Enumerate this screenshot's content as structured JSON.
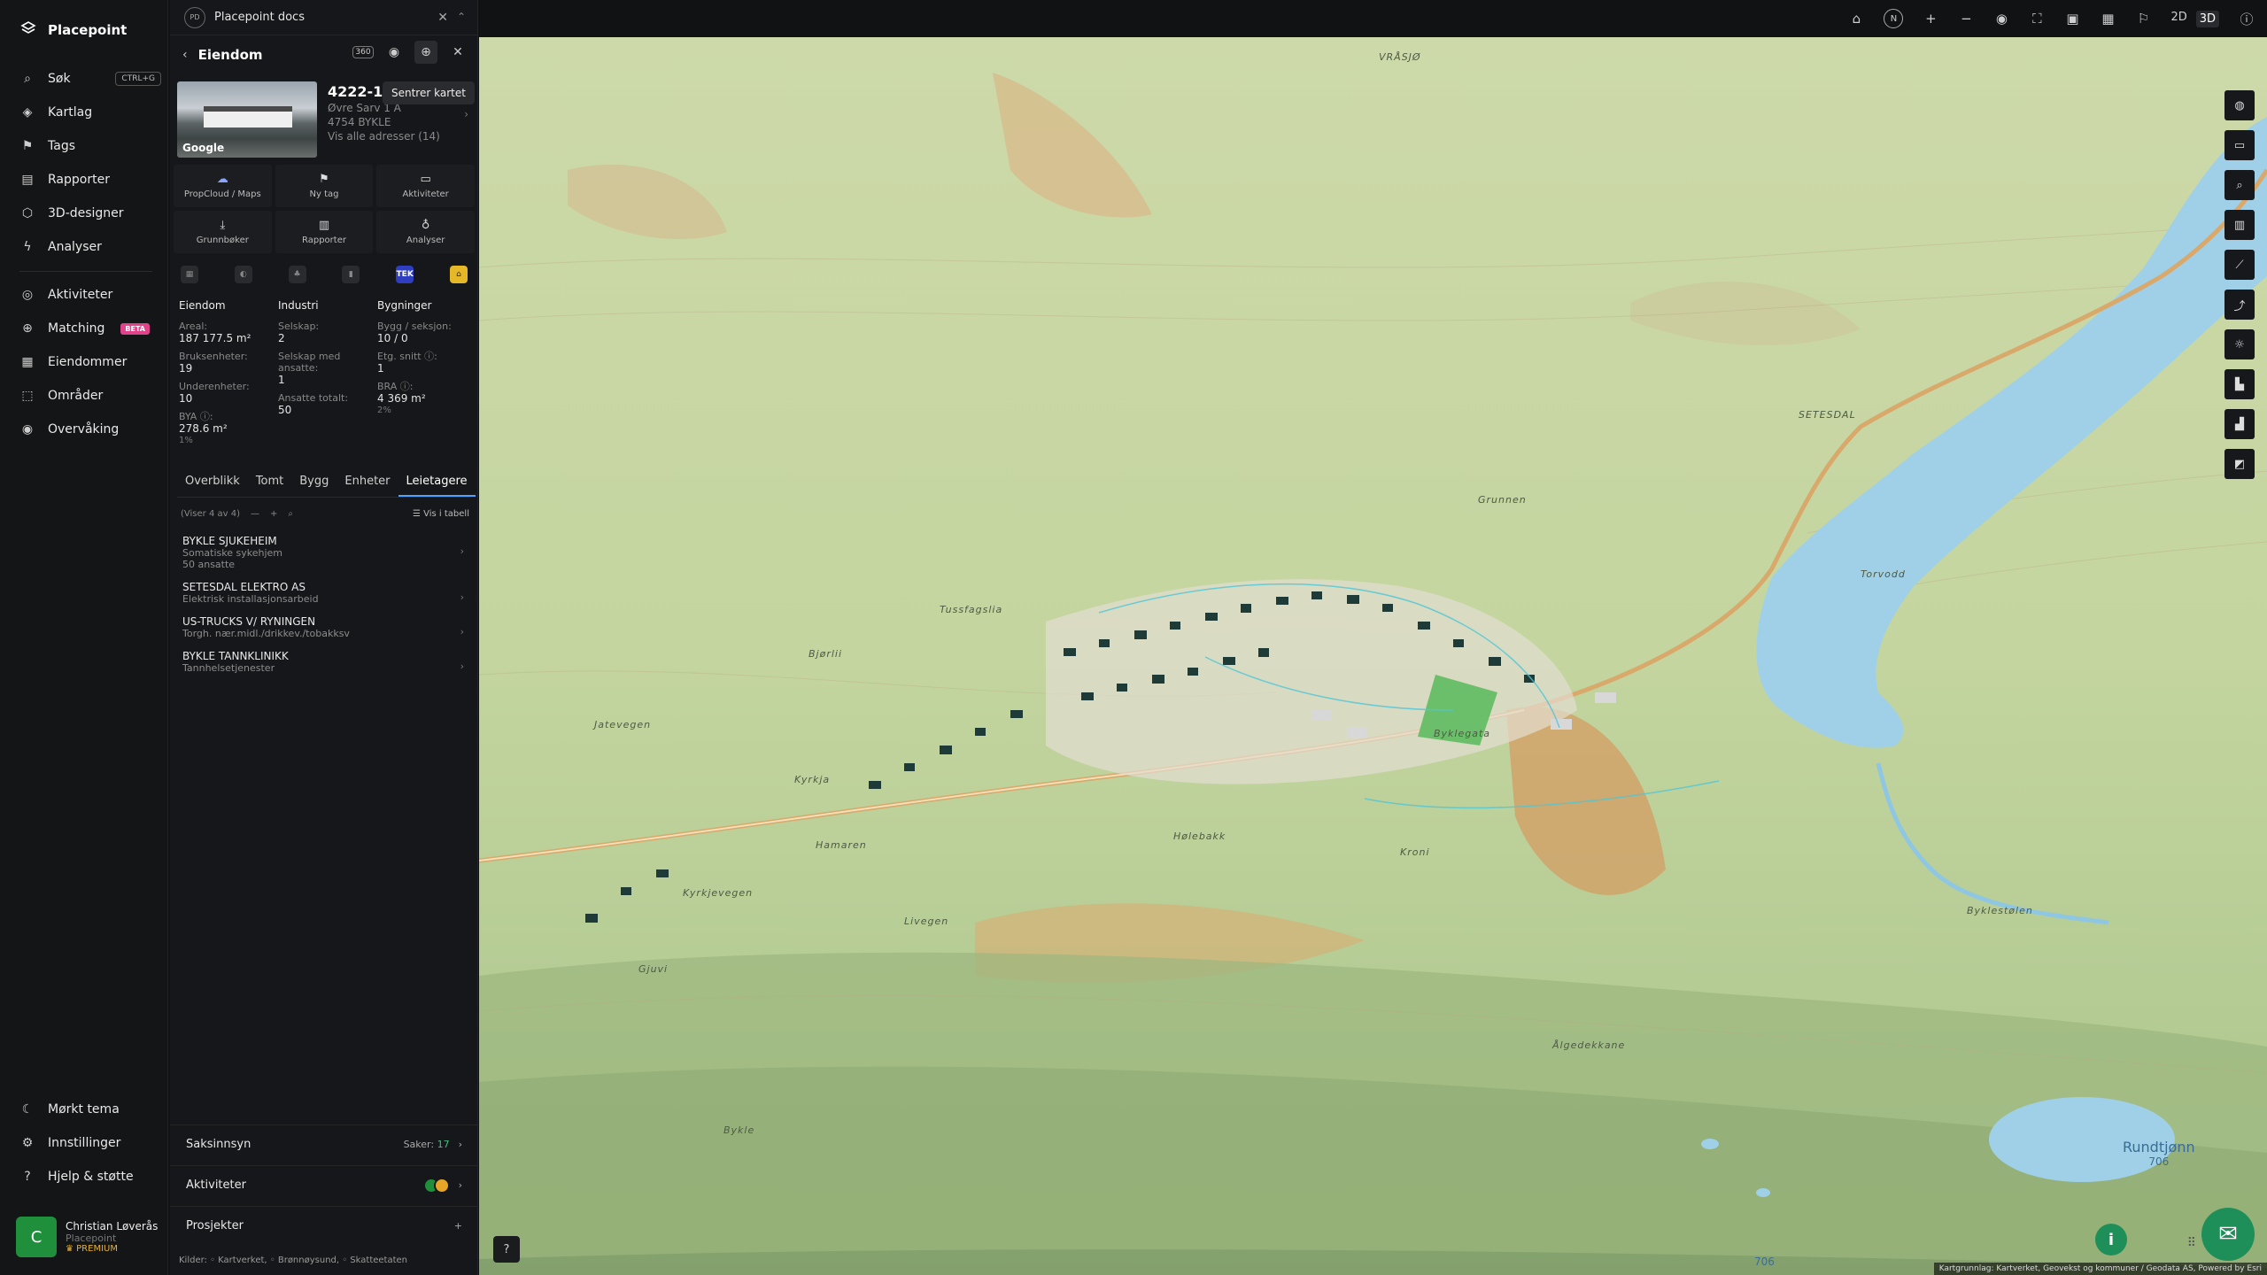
{
  "brand": {
    "name": "Placepoint"
  },
  "nav": {
    "items": [
      {
        "icon": "search-icon",
        "label": "Søk",
        "shortcut": "CTRL+G"
      },
      {
        "icon": "layers-icon",
        "label": "Kartlag"
      },
      {
        "icon": "tag-icon",
        "label": "Tags"
      },
      {
        "icon": "chart-icon",
        "label": "Rapporter"
      },
      {
        "icon": "cube-icon",
        "label": "3D-designer"
      },
      {
        "icon": "bolt-icon",
        "label": "Analyser"
      },
      {
        "icon": "activity-icon",
        "label": "Aktiviteter"
      },
      {
        "icon": "target-icon",
        "label": "Matching",
        "badge": "BETA"
      },
      {
        "icon": "building-icon",
        "label": "Eiendommer"
      },
      {
        "icon": "area-icon",
        "label": "Områder"
      },
      {
        "icon": "monitor-icon",
        "label": "Overvåking"
      }
    ],
    "footer": [
      {
        "icon": "moon-icon",
        "label": "Mørkt tema"
      },
      {
        "icon": "gear-icon",
        "label": "Innstillinger"
      },
      {
        "icon": "help-icon",
        "label": "Hjelp & støtte"
      }
    ],
    "user": {
      "initial": "C",
      "name": "Christian Løverås",
      "org": "Placepoint",
      "plan": "PREMIUM"
    }
  },
  "panel": {
    "tab_badge": "PD",
    "tab_title": "Placepoint docs",
    "title": "Eiendom",
    "tooltip": "Sentrer kartet",
    "thumb_logo": "Google",
    "address": {
      "code": "4222-15",
      "street": "Øvre Sarv 1 A",
      "postal": "4754 BYKLE",
      "all": "Vis alle adresser (14)"
    },
    "actions": [
      {
        "icon": "propcloud-icon",
        "label": "PropCloud / Maps"
      },
      {
        "icon": "tag-icon",
        "label": "Ny tag"
      },
      {
        "icon": "activity-icon",
        "label": "Aktiviteter"
      },
      {
        "icon": "download-icon",
        "label": "Grunnbøker"
      },
      {
        "icon": "chart-icon",
        "label": "Rapporter"
      },
      {
        "icon": "bulb-icon",
        "label": "Analyser"
      }
    ],
    "minis": [
      "grid-icon",
      "globe-icon",
      "plant-icon",
      "bars-icon",
      "TEK",
      "home-icon"
    ],
    "stats": {
      "eiendom": {
        "title": "Eiendom",
        "areal_l": "Areal:",
        "areal_v": "187 177.5 m²",
        "bruks_l": "Bruksenheter:",
        "bruks_v": "19",
        "under_l": "Underenheter:",
        "under_v": "10",
        "bya_l": "BYA ⓘ:",
        "bya_v": "278.6 m²",
        "bya_p": "1%"
      },
      "industri": {
        "title": "Industri",
        "selskap_l": "Selskap:",
        "selskap_v": "2",
        "ansatte_l": "Selskap med ansatte:",
        "ansatte_v": "1",
        "tot_l": "Ansatte totalt:",
        "tot_v": "50"
      },
      "bygninger": {
        "title": "Bygninger",
        "bygg_l": "Bygg / seksjon:",
        "bygg_v": "10 / 0",
        "etg_l": "Etg. snitt ⓘ:",
        "etg_v": "1",
        "bra_l": "BRA ⓘ:",
        "bra_v": "4 369 m²",
        "bra_p": "2%"
      }
    },
    "tabs": [
      "Overblikk",
      "Tomt",
      "Bygg",
      "Enheter",
      "Leietagere"
    ],
    "listbar": {
      "count": "(Viser 4 av 4)",
      "table": "Vis i tabell"
    },
    "tenants": [
      {
        "name": "BYKLE SJUKEHEIM",
        "sub": "Somatiske sykehjem",
        "extra": "50 ansatte"
      },
      {
        "name": "SETESDAL ELEKTRO AS",
        "sub": "Elektrisk installasjonsarbeid"
      },
      {
        "name": "US-TRUCKS V/ RYNINGEN",
        "sub": "Torgh. nær.midl./drikkev./tobakksv"
      },
      {
        "name": "BYKLE TANNKLINIKK",
        "sub": "Tannhelsetjenester"
      }
    ],
    "saksinnsyn": {
      "label": "Saksinnsyn",
      "cases_l": "Saker:",
      "cases_v": "17"
    },
    "aktiviteter": {
      "label": "Aktiviteter"
    },
    "prosjekter": {
      "label": "Prosjekter"
    },
    "sources": "Kilder: ◦ Kartverket, ◦ Brønnøysund, ◦ Skatteetaten"
  },
  "topbar": {
    "compass": "N",
    "mode2d": "2D",
    "mode3d": "3D"
  },
  "map": {
    "labels": [
      "VRÅSJØ",
      "SETESDAL",
      "Bjørlii",
      "Jatevegen",
      "Kyrkja",
      "Hamaren",
      "Livegen",
      "Gjuvi",
      "Hølebakk",
      "Kroni",
      "Torvodd",
      "Tussfagslia",
      "Grunnen",
      "Byklegata",
      "Kyrkjevegen",
      "Ålgedekkane",
      "Byklestølen",
      "Bykle"
    ],
    "lake": {
      "name": "Rundtjønn",
      "elev": "706"
    },
    "elev_bottom": "706",
    "attribution": "Kartgrunnlag: Kartverket, Geovekst og kommuner / Geodata AS, Powered by Esri"
  },
  "colors": {
    "accent": "#4fa3ff",
    "fab": "#1f8f5a",
    "beta": "#e0438a"
  }
}
